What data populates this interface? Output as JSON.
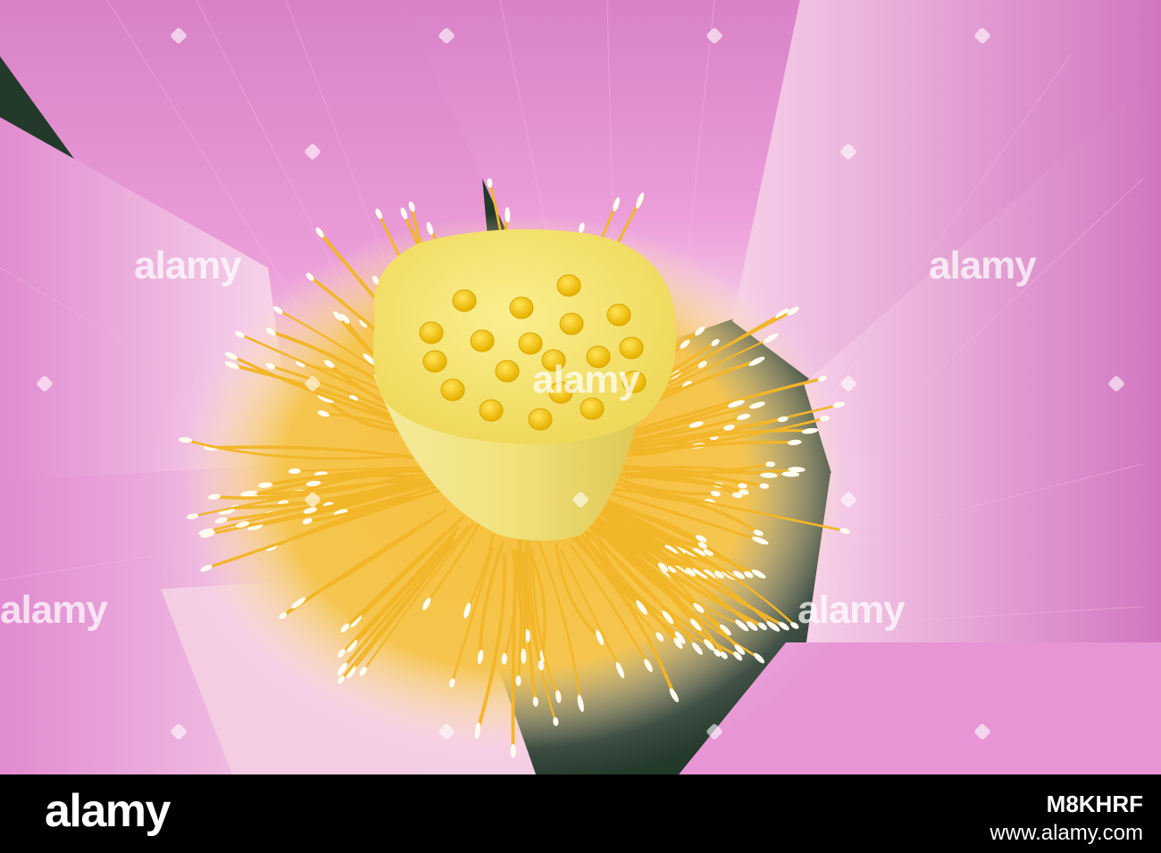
{
  "image": {
    "subject": "lotus-flower",
    "colors": {
      "petal": "#e58bd0",
      "petal_light": "#f7d2ea",
      "seed_pod": "#f5e56b",
      "stamen": "#f2b629",
      "filament_tip": "#fffdf0",
      "background": "#2f4a33"
    }
  },
  "watermarks": [
    "alamy",
    "alamy",
    "alamy",
    "alamy",
    "alamy",
    "alamy"
  ],
  "footer": {
    "logo": "alamy",
    "image_id": "M8KHRF",
    "url": "www.alamy.com"
  }
}
